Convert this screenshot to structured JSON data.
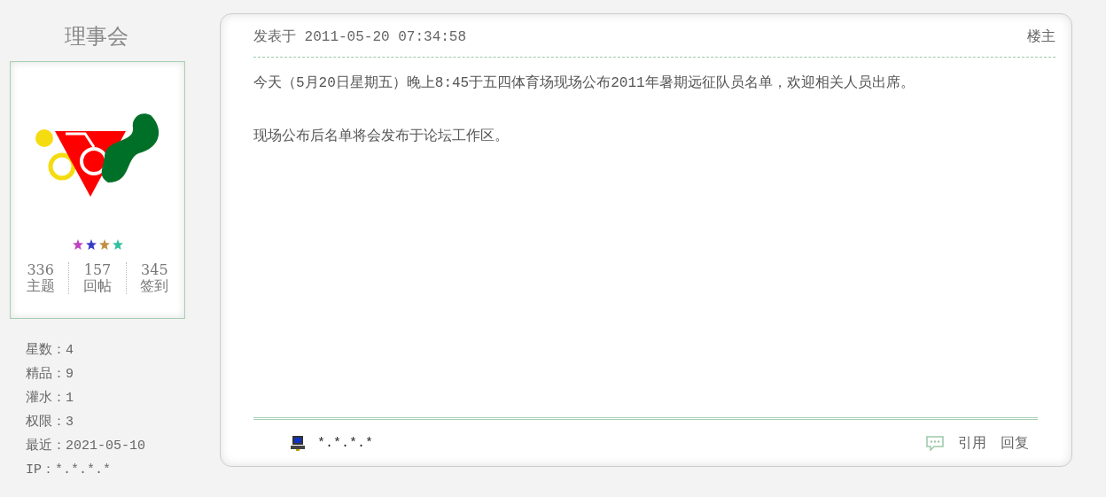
{
  "user": {
    "group": "理事会",
    "rank_stars": [
      {
        "color": "#c040c0"
      },
      {
        "color": "#3838c8"
      },
      {
        "color": "#c09040"
      },
      {
        "color": "#30c0a0"
      }
    ],
    "stats": [
      {
        "value": "336",
        "label": "主题"
      },
      {
        "value": "157",
        "label": "回帖"
      },
      {
        "value": "345",
        "label": "签到"
      }
    ],
    "info": [
      "星数：4",
      "精品：9",
      "灌水：1",
      "权限：3",
      "最近：2021-05-10",
      "IP：*.*.*.*"
    ]
  },
  "post": {
    "posted": "发表于 2011-05-20 07:34:58",
    "floor": "楼主",
    "paragraphs": [
      "今天（5月20日星期五）晚上8:45于五四体育场现场公布2011年暑期远征队员名单，欢迎相关人员出席。",
      "现场公布后名单将会发布于论坛工作区。"
    ],
    "ip": "*.*.*.*",
    "actions": [
      "引用",
      "回复"
    ]
  }
}
